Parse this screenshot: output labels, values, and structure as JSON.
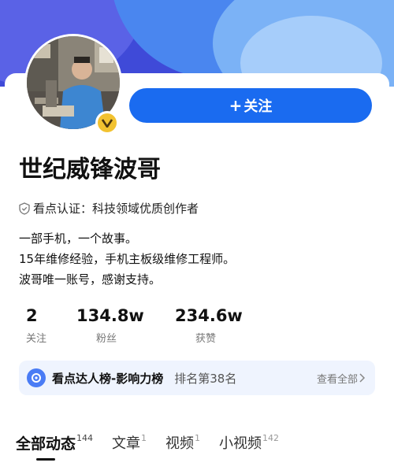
{
  "colors": {
    "banner": "#3f4ad8",
    "accent": "#1a6bf0",
    "badge": "#f2c230",
    "rank_bg": "#eff4fe"
  },
  "profile": {
    "name": "世纪威锋波哥",
    "verified_icon": "verified-v-icon",
    "certification": "看点认证：科技领域优质创作者",
    "bio": [
      "一部手机，一个故事。",
      "15年维修经验，手机主板级维修工程师。",
      "波哥唯一账号，感谢支持。"
    ]
  },
  "follow_button": {
    "icon": "plus-icon",
    "label": "关注"
  },
  "stats": [
    {
      "value": "2",
      "label": "关注"
    },
    {
      "value": "134.8w",
      "label": "粉丝"
    },
    {
      "value": "234.6w",
      "label": "获赞"
    }
  ],
  "ranking": {
    "title": "看点达人榜-影响力榜",
    "position": "排名第38名",
    "view_all": "查看全部"
  },
  "tabs": [
    {
      "label": "全部动态",
      "count": "144",
      "active": true
    },
    {
      "label": "文章",
      "count": "1"
    },
    {
      "label": "视频",
      "count": "1"
    },
    {
      "label": "小视频",
      "count": "142"
    }
  ]
}
